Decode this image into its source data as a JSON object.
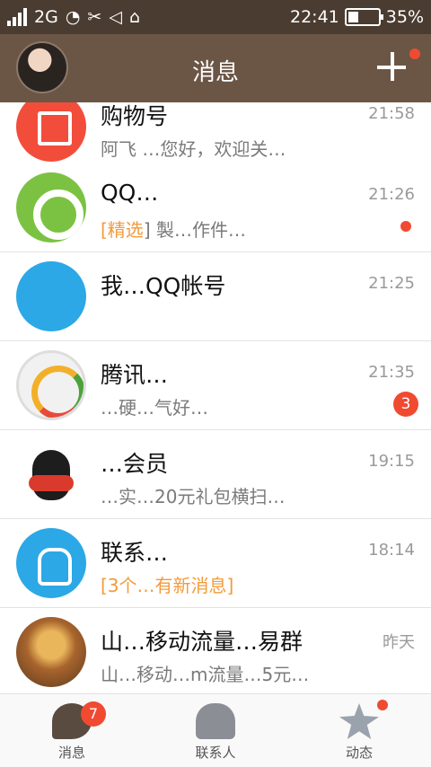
{
  "status_bar": {
    "network": "2G",
    "time": "22:41",
    "battery": "35%",
    "battery_fraction": 0.35
  },
  "header": {
    "title": "消息"
  },
  "conversations": [
    {
      "name": "购物号",
      "preview": "阿飞 …您好，欢迎关…",
      "time": "21:58"
    },
    {
      "name": "QQ…",
      "preview_highlight": "[精选",
      "preview": "] 製…作件…",
      "time": "21:26",
      "unread_dot": true
    },
    {
      "name": "我…QQ帐号",
      "preview": "",
      "time": "21:25"
    },
    {
      "name": "腾讯…",
      "preview": "…硬…气好…",
      "time": "21:35",
      "badge": "3"
    },
    {
      "name": "…会员",
      "preview": "…实…20元礼包横扫…",
      "time": "19:15"
    },
    {
      "name": "联系…",
      "preview_highlight": "[3个…有新消息]",
      "preview": "",
      "time": "18:14"
    },
    {
      "name": "山…移动流量…易群",
      "preview": "山…移动…m流量…5元…",
      "time": "昨天"
    }
  ],
  "tabs": [
    {
      "label": "消息",
      "badge": "7"
    },
    {
      "label": "联系人"
    },
    {
      "label": "动态"
    }
  ]
}
